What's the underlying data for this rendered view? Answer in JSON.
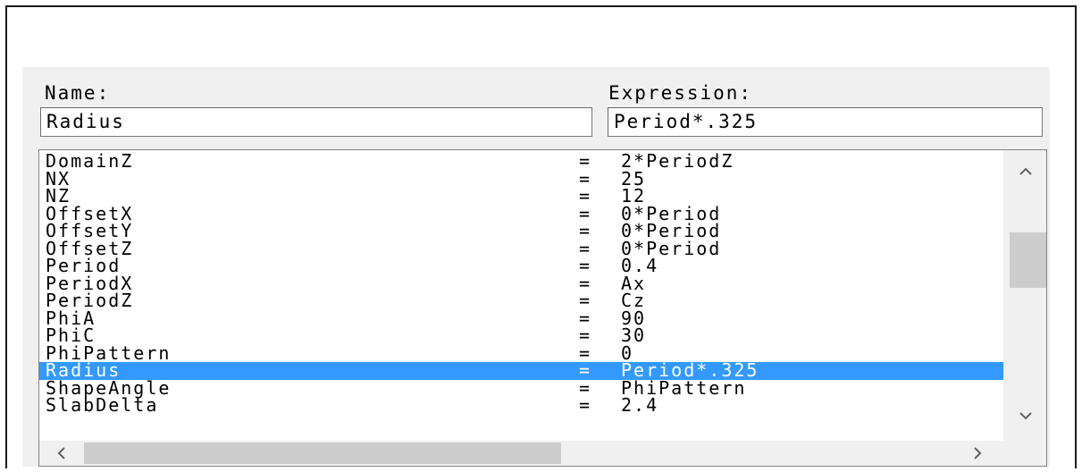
{
  "name_field": {
    "label": "Name:",
    "value": "Radius"
  },
  "expression_field": {
    "label": "Expression:",
    "value": "Period*.325"
  },
  "variables": [
    {
      "name": "DomainZ",
      "eq": "=",
      "value": "2*PeriodZ"
    },
    {
      "name": "NX",
      "eq": "=",
      "value": "25"
    },
    {
      "name": "NZ",
      "eq": "=",
      "value": "12"
    },
    {
      "name": "OffsetX",
      "eq": "=",
      "value": "0*Period"
    },
    {
      "name": "OffsetY",
      "eq": "=",
      "value": "0*Period"
    },
    {
      "name": "OffsetZ",
      "eq": "=",
      "value": "0*Period"
    },
    {
      "name": "Period",
      "eq": "=",
      "value": "0.4"
    },
    {
      "name": "PeriodX",
      "eq": "=",
      "value": "Ax"
    },
    {
      "name": "PeriodZ",
      "eq": "=",
      "value": "Cz"
    },
    {
      "name": "PhiA",
      "eq": "=",
      "value": "90"
    },
    {
      "name": "PhiC",
      "eq": "=",
      "value": "30"
    },
    {
      "name": "PhiPattern",
      "eq": "=",
      "value": "0"
    },
    {
      "name": "Radius",
      "eq": "=",
      "value": "Period*.325"
    },
    {
      "name": "ShapeAngle",
      "eq": "=",
      "value": "PhiPattern"
    },
    {
      "name": "SlabDelta",
      "eq": "=",
      "value": "2.4"
    }
  ],
  "selected_variable": "Radius",
  "colors": {
    "selection": "#3399ff",
    "panel": "#f0f0f0",
    "scroll_thumb": "#cdcdcd"
  },
  "icons": {
    "scroll_up": "chevron-up-icon",
    "scroll_down": "chevron-down-icon",
    "scroll_left": "chevron-left-icon",
    "scroll_right": "chevron-right-icon"
  }
}
